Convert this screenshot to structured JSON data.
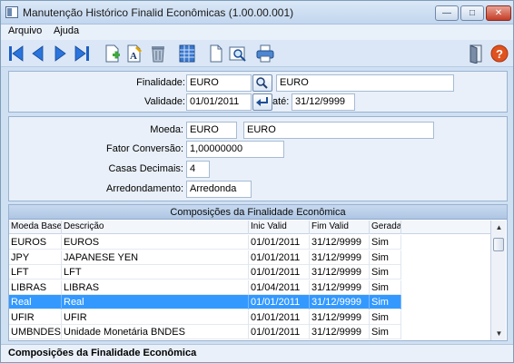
{
  "window": {
    "title": "Manutenção Histórico Finalid Econômicas (1.00.00.001)",
    "min_label": "—",
    "max_label": "□",
    "close_label": "✕"
  },
  "menu": {
    "items": [
      "Arquivo",
      "Ajuda"
    ]
  },
  "toolbar": {
    "icons": [
      "first-record-icon",
      "previous-record-icon",
      "next-record-icon",
      "last-record-icon",
      "add-record-icon",
      "edit-record-icon",
      "delete-record-icon",
      "grid-view-icon",
      "document-icon",
      "zoom-icon",
      "print-icon",
      "exit-icon",
      "help-icon"
    ]
  },
  "header_form": {
    "finalidade_label": "Finalidade:",
    "finalidade_code": "EURO",
    "finalidade_desc": "EURO",
    "validade_label": "Validade:",
    "validade_from": "01/01/2011",
    "ate_label": "até:",
    "validade_to": "31/12/9999"
  },
  "detail_form": {
    "moeda_label": "Moeda:",
    "moeda_code": "EURO",
    "moeda_desc": "EURO",
    "fator_label": "Fator Conversão:",
    "fator_value": "1,00000000",
    "casas_label": "Casas Decimais:",
    "casas_value": "4",
    "arred_label": "Arredondamento:",
    "arred_value": "Arredonda"
  },
  "grid": {
    "title": "Composições da Finalidade Econômica",
    "columns": [
      "Moeda Base",
      "Descrição",
      "Inic Valid",
      "Fim Valid",
      "Gerada"
    ],
    "rows": [
      [
        "EUROS",
        "EUROS",
        "01/01/2011",
        "31/12/9999",
        "Sim"
      ],
      [
        "JPY",
        "JAPANESE YEN",
        "01/01/2011",
        "31/12/9999",
        "Sim"
      ],
      [
        "LFT",
        "LFT",
        "01/01/2011",
        "31/12/9999",
        "Sim"
      ],
      [
        "LIBRAS",
        "LIBRAS",
        "01/04/2011",
        "31/12/9999",
        "Sim"
      ],
      [
        "Real",
        "Real",
        "01/01/2011",
        "31/12/9999",
        "Sim"
      ],
      [
        "UFIR",
        "UFIR",
        "01/01/2011",
        "31/12/9999",
        "Sim"
      ],
      [
        "UMBNDES",
        "Unidade Monetária BNDES",
        "01/01/2011",
        "31/12/9999",
        "Sim"
      ]
    ],
    "selected_index": 4
  },
  "statusbar": {
    "text": "Composições da Finalidade Econômica"
  }
}
